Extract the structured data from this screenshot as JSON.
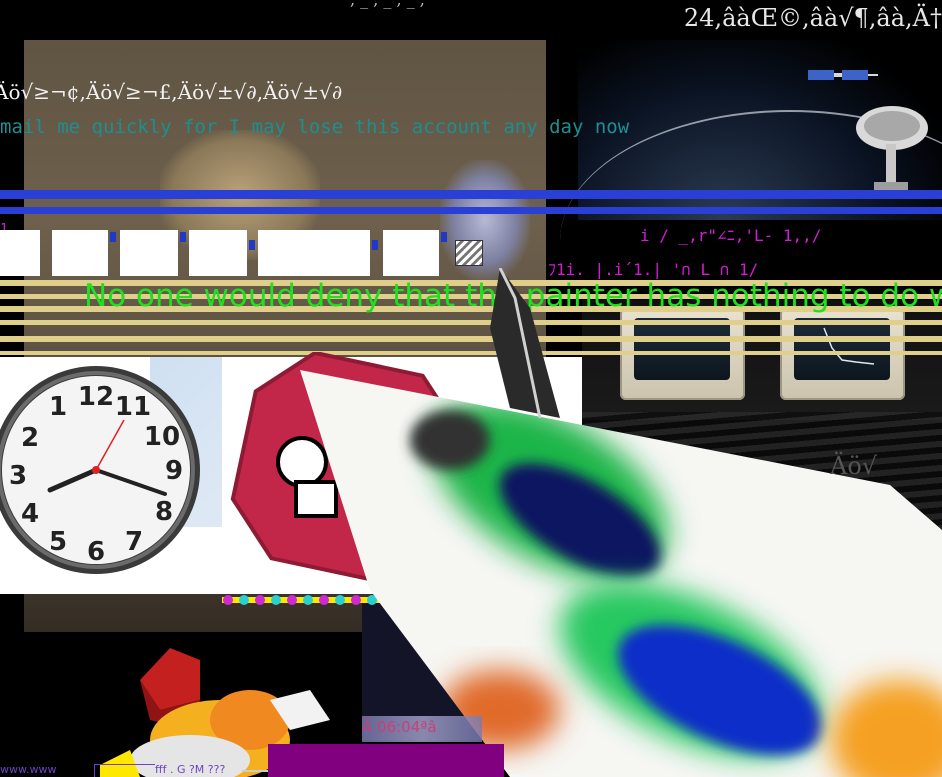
{
  "top": {
    "right_text": "24,âàŒ©,âà√¶,âà,Ä†"
  },
  "overlay_text": {
    "mojibake_line": "Äö√≥¬¢,Äö√≥¬£,Äö√±√∂,Äö√±√∂",
    "email_line": "mail me quickly for I may lose this account any day now",
    "green_line": "No one would deny that the painter has nothing to do with",
    "magenta_row1": "i          /   _,r\"∠ﾆ,'L- 1,,/",
    "magenta_row2": "ﾌ1i.     |.i´1.|     '∩ L ∩ 1/",
    "magenta_short_left": "1",
    "ghost_right": "Äö√",
    "glitch_bottom": "Ä 06:04ªâ"
  },
  "clock": {
    "numbers": [
      "12",
      "11",
      "10",
      "9",
      "8",
      "7",
      "6",
      "5",
      "4",
      "3",
      "2",
      "1"
    ]
  },
  "bottom_bar": {
    "left_text": "www.www",
    "mid_text": "fff . G ?M ???"
  },
  "icons": {
    "satellite": "satellite-icon",
    "dish": "satellite-dish-icon",
    "stop_sign": "stop-sign-icon",
    "clock": "wall-clock-icon"
  },
  "colors": {
    "green_text": "#1fe01f",
    "teal_text": "#1e8f8f",
    "magenta_text": "#d51cd5",
    "blue_stripe": "#2a3fd6",
    "tan_stripe": "#e0cf8b",
    "purple_block": "#800080",
    "stop_red": "#c2274a"
  }
}
